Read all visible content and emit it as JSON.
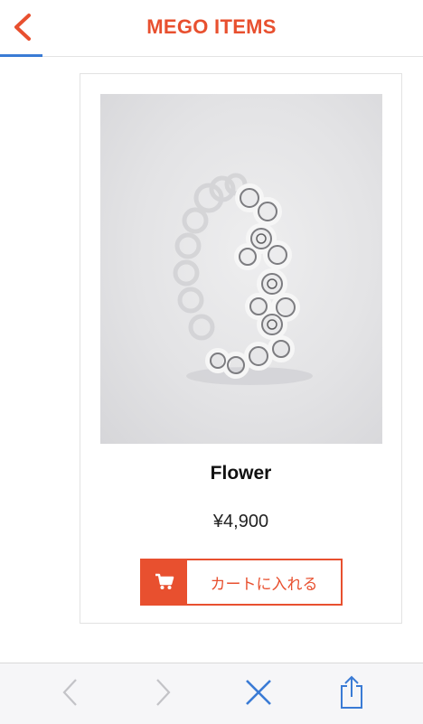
{
  "header": {
    "title": "MEGO ITEMS",
    "back_icon": "chevron-left-icon",
    "accent": "#e8502f"
  },
  "product": {
    "name": "Flower",
    "price": "¥4,900",
    "cart_button_label": "カートに入れる",
    "cart_icon": "cart-icon"
  },
  "toolbar": {
    "icons": [
      "back-arrow-icon",
      "forward-arrow-icon",
      "close-icon",
      "share-icon"
    ],
    "accent": "#3a7bd5"
  }
}
